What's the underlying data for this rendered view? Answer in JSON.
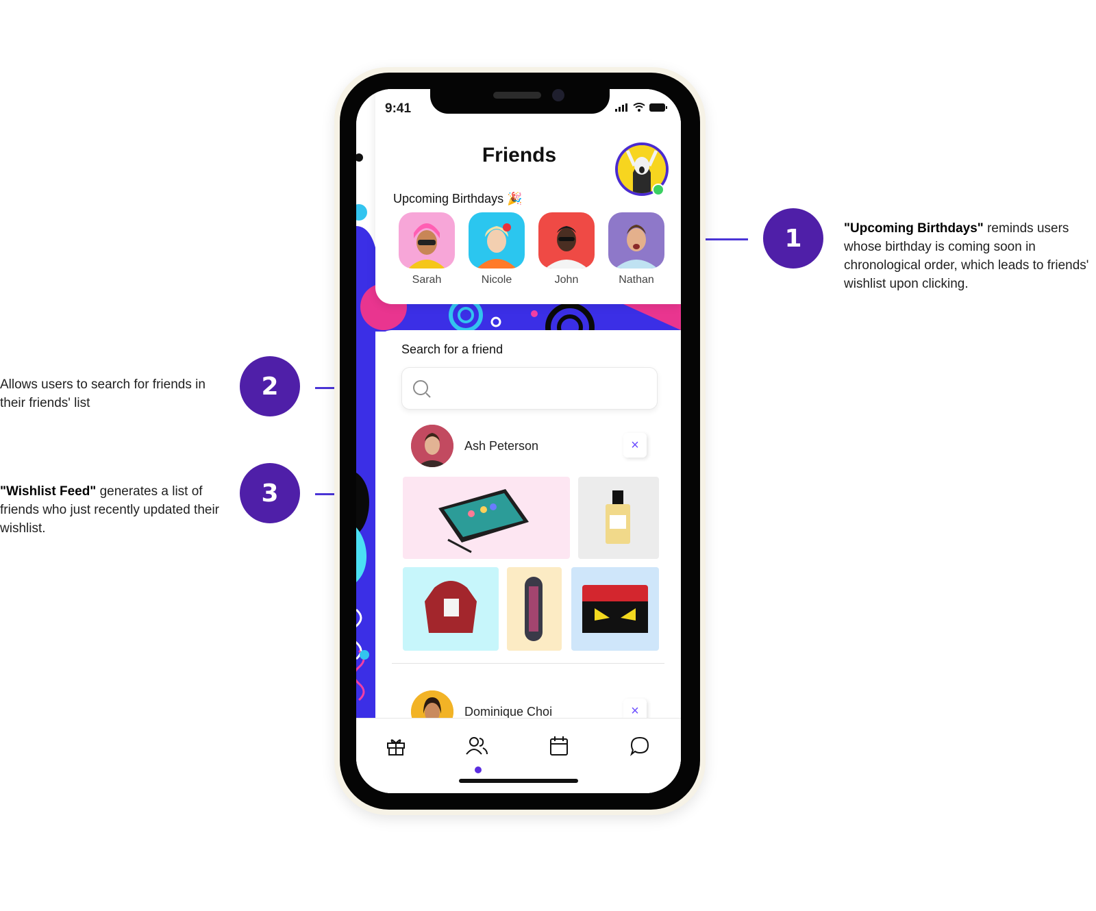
{
  "status_bar": {
    "time": "9:41"
  },
  "page_title": "Friends",
  "birthdays": {
    "title": "Upcoming Birthdays",
    "people": [
      {
        "name": "Sarah",
        "bg": "#f7a6d8"
      },
      {
        "name": "Nicole",
        "bg": "#2bc6ef"
      },
      {
        "name": "John",
        "bg": "#ef4a45"
      },
      {
        "name": "Nathan",
        "bg": "#8e78c9"
      }
    ]
  },
  "search": {
    "label": "Search for a friend",
    "placeholder": ""
  },
  "feed": [
    {
      "name": "Ash Peterson",
      "remove": "×"
    },
    {
      "name": "Dominique Choi",
      "remove": "×"
    }
  ],
  "tabs": [
    {
      "icon": "gift-icon"
    },
    {
      "icon": "friends-icon"
    },
    {
      "icon": "calendar-icon"
    },
    {
      "icon": "chat-icon"
    }
  ],
  "annotations": [
    {
      "number": "1",
      "bold": "\"Upcoming Birthdays\"",
      "text": " reminds users whose birthday is coming soon in chronological order, which leads to friends' wishlist upon clicking."
    },
    {
      "number": "2",
      "text": "Allows users to search for friends in their friends' list"
    },
    {
      "number": "3",
      "bold": "\"Wishlist Feed\"",
      "text": " generates a list of friends who just recently updated their wishlist."
    }
  ],
  "colors": {
    "accent": "#4f1fa8",
    "line": "#4a34d6",
    "remove_x": "#6a4cff",
    "tab_active_dot": "#5b2de0"
  }
}
